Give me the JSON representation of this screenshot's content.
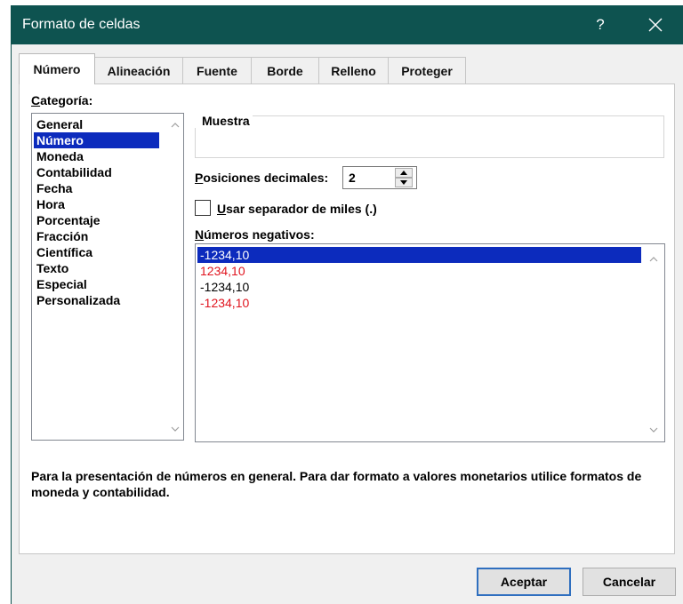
{
  "window": {
    "title": "Formato de celdas",
    "help_label": "?"
  },
  "tabs": [
    {
      "label": "Número",
      "active": true
    },
    {
      "label": "Alineación",
      "active": false
    },
    {
      "label": "Fuente",
      "active": false
    },
    {
      "label": "Borde",
      "active": false
    },
    {
      "label": "Relleno",
      "active": false
    },
    {
      "label": "Proteger",
      "active": false
    }
  ],
  "category": {
    "label_first": "C",
    "label_rest": "ategoría:",
    "items": [
      "General",
      "Número",
      "Moneda",
      "Contabilidad",
      "Fecha",
      "Hora",
      "Porcentaje",
      "Fracción",
      "Científica",
      "Texto",
      "Especial",
      "Personalizada"
    ],
    "selected": "Número"
  },
  "sample": {
    "title": "Muestra"
  },
  "decimals": {
    "label_first": "P",
    "label_rest": "osiciones decimales:",
    "value": "2"
  },
  "thousands": {
    "label_first": "U",
    "label_rest": "sar separador de miles (.)",
    "checked": false
  },
  "negatives": {
    "label_first": "N",
    "label_rest": "úmeros negativos:",
    "items": [
      {
        "text": "-1234,10",
        "color": "#ffffff",
        "selected": true
      },
      {
        "text": "1234,10",
        "color": "#e0141e",
        "selected": false
      },
      {
        "text": "-1234,10",
        "color": "#000000",
        "selected": false
      },
      {
        "text": "-1234,10",
        "color": "#e0141e",
        "selected": false
      }
    ]
  },
  "description": "Para la presentación de números en general. Para dar formato a valores monetarios utilice formatos de moneda y contabilidad.",
  "buttons": {
    "ok": "Aceptar",
    "cancel": "Cancelar"
  },
  "colors": {
    "titlebar": "#0e5350",
    "selection": "#0c2bbd",
    "negative_red": "#e0141e"
  }
}
